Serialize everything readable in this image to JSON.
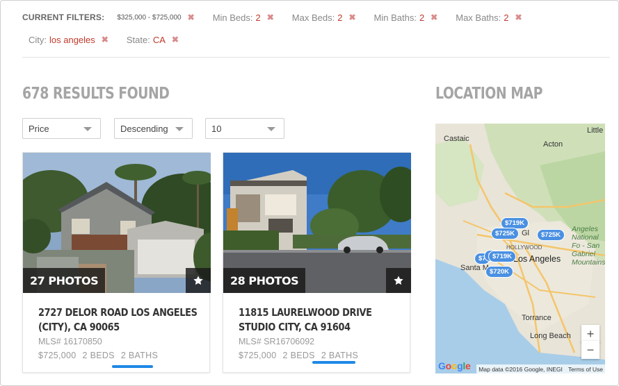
{
  "filters": {
    "title": "CURRENT FILTERS:",
    "price": "$325,000 - $725,000",
    "min_beds_label": "Min Beds:",
    "min_beds_value": "2",
    "max_beds_label": "Max Beds:",
    "max_beds_value": "2",
    "min_baths_label": "Min Baths:",
    "min_baths_value": "2",
    "max_baths_label": "Max Baths:",
    "max_baths_value": "2",
    "city_label": "City:",
    "city_value": "los angeles",
    "state_label": "State:",
    "state_value": "CA",
    "remove_glyph": "✖"
  },
  "results": {
    "title": "678 RESULTS FOUND"
  },
  "sort": {
    "field": "Price",
    "order": "Descending",
    "per_page": "10"
  },
  "listings": [
    {
      "photos": "27 PHOTOS",
      "address": "2727 DELOR ROAD LOS ANGELES (CITY), CA 90065",
      "mls": "MLS# 16170850",
      "price": "$725,000",
      "beds": "2 BEDS",
      "baths": "2 BATHS"
    },
    {
      "photos": "28 PHOTOS",
      "address": "11815 LAURELWOOD DRIVE STUDIO CITY, CA 91604",
      "mls": "MLS# SR16706092",
      "price": "$725,000",
      "beds": "2 BEDS",
      "baths": "2 BATHS"
    }
  ],
  "map": {
    "title": "LOCATION MAP",
    "places": {
      "castaic": "Castaic",
      "acton": "Acton",
      "littlerock": "Little",
      "hollywood": "HOLLYWOOD",
      "la": "Los Angeles",
      "santa_monica": "Santa M",
      "torrance": "Torrance",
      "long_beach": "Long Beach",
      "angeles_forest": "Angeles National Fo - San Gabriel Mountains",
      "gl": "Gl"
    },
    "pins": [
      "$719K",
      "$725K",
      "$725K",
      "$719K",
      "$720K",
      "$7",
      "$7"
    ],
    "zoom_in": "+",
    "zoom_out": "−",
    "attribution": "Map data ©2016 Google, INEGI",
    "terms": "Terms of Use",
    "google": "Google"
  },
  "colors": {
    "accent": "#1e88e5",
    "filter_value": "#c0392b",
    "pin": "#4a90e2"
  }
}
